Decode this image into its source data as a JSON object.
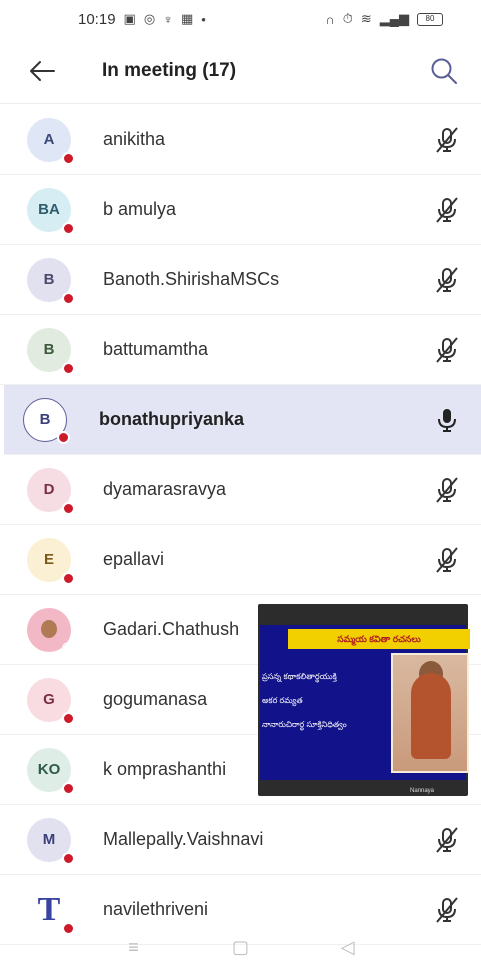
{
  "status_bar": {
    "time": "10:19",
    "battery": "80"
  },
  "header": {
    "title": "In meeting (17)"
  },
  "participants": [
    {
      "initials": "A",
      "name": "anikitha",
      "mic": "muted",
      "avatar_bg": "#dfe6f5",
      "avatar_fg": "#3b4a7a"
    },
    {
      "initials": "BA",
      "name": "b amulya",
      "mic": "muted",
      "avatar_bg": "#d6eef3",
      "avatar_fg": "#2f5d6b"
    },
    {
      "initials": "B",
      "name": "Banoth.ShirishaMSCs",
      "mic": "muted",
      "avatar_bg": "#e2e1ef",
      "avatar_fg": "#4a4a6a"
    },
    {
      "initials": "B",
      "name": "battumamtha",
      "mic": "muted",
      "avatar_bg": "#e1ebe0",
      "avatar_fg": "#3d5a3b"
    },
    {
      "initials": "B",
      "name": "bonathupriyanka",
      "mic": "on",
      "avatar_bg": "#ffffff",
      "avatar_fg": "#3b3f7a"
    },
    {
      "initials": "D",
      "name": "dyamarasravya",
      "mic": "muted",
      "avatar_bg": "#f6dde3",
      "avatar_fg": "#7a2f45"
    },
    {
      "initials": "E",
      "name": "epallavi",
      "mic": "muted",
      "avatar_bg": "#fbf0d4",
      "avatar_fg": "#7a5a1a"
    },
    {
      "initials": "",
      "name": "Gadari.Chathush",
      "mic": "muted",
      "avatar_bg": "#f3b8c6",
      "avatar_fg": "#333333"
    },
    {
      "initials": "G",
      "name": "gogumanasa",
      "mic": "muted",
      "avatar_bg": "#f8dce2",
      "avatar_fg": "#7a2f45"
    },
    {
      "initials": "KO",
      "name": "k omprashanthi",
      "mic": "muted",
      "avatar_bg": "#deede6",
      "avatar_fg": "#2f5a45"
    },
    {
      "initials": "M",
      "name": "Mallepally.Vaishnavi",
      "mic": "muted",
      "avatar_bg": "#e2e1ef",
      "avatar_fg": "#3b3f7a"
    },
    {
      "initials": "T",
      "name": "navilethriveni",
      "mic": "muted",
      "avatar_bg": "#ffffff",
      "avatar_fg": "#3a44a0"
    }
  ],
  "video": {
    "slide_title": "సమ్మయ కవితా రచనలు",
    "slide_lines": [
      "ప్రసన్న కథాకలితార్థయుక్తి",
      "అకర రమ్యత",
      "నానారుచిరార్థ సూక్తినిధిత్వం"
    ],
    "caption": "Nannaya"
  },
  "nav": {
    "recent_icon": "≡",
    "home_icon": "▢",
    "back_icon": "◁"
  }
}
